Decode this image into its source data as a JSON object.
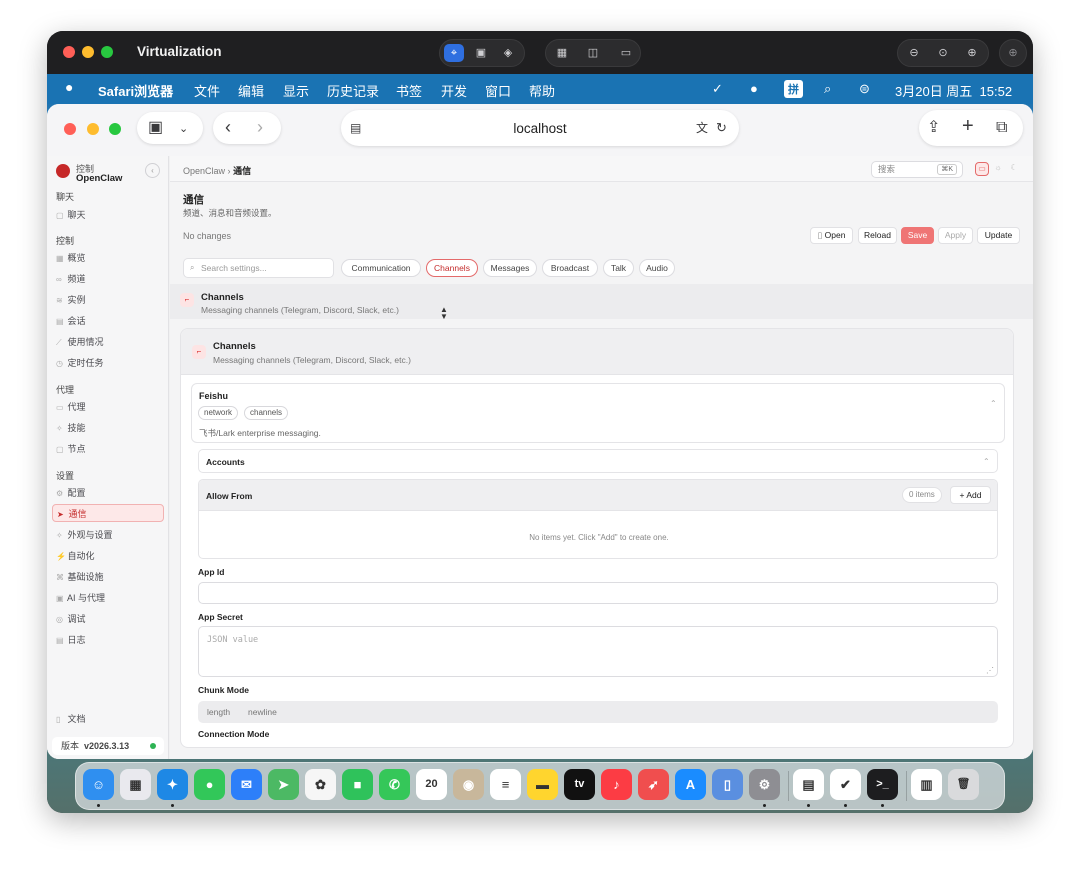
{
  "vm": {
    "title": "Virtualization"
  },
  "menubar": {
    "apple": "",
    "items": [
      "Safari浏览器",
      "文件",
      "编辑",
      "显示",
      "历史记录",
      "书签",
      "开发",
      "窗口",
      "帮助"
    ],
    "input_method": "拼",
    "datetime": "3月20日 周五  15:52"
  },
  "safari": {
    "url": "localhost"
  },
  "sidebar": {
    "brand_small": "控制",
    "brand_name": "OpenClaw",
    "groups": [
      {
        "label": "聊天",
        "items": [
          {
            "label": "聊天",
            "icon": "chat-icon"
          }
        ]
      },
      {
        "label": "控制",
        "items": [
          {
            "label": "概览",
            "icon": "overview-icon"
          },
          {
            "label": "频道",
            "icon": "link-icon"
          },
          {
            "label": "实例",
            "icon": "instance-icon"
          },
          {
            "label": "会话",
            "icon": "session-icon"
          },
          {
            "label": "使用情况",
            "icon": "usage-icon"
          },
          {
            "label": "定时任务",
            "icon": "clock-icon"
          }
        ]
      },
      {
        "label": "代理",
        "items": [
          {
            "label": "代理",
            "icon": "folder-icon"
          },
          {
            "label": "技能",
            "icon": "skill-icon"
          },
          {
            "label": "节点",
            "icon": "node-icon"
          }
        ]
      },
      {
        "label": "设置",
        "items": [
          {
            "label": "配置",
            "icon": "gear-icon"
          },
          {
            "label": "通信",
            "icon": "send-icon"
          },
          {
            "label": "外观与设置",
            "icon": "appearance-icon"
          },
          {
            "label": "自动化",
            "icon": "automation-icon"
          },
          {
            "label": "基础设施",
            "icon": "infra-icon"
          },
          {
            "label": "AI 与代理",
            "icon": "ai-icon"
          },
          {
            "label": "调试",
            "icon": "debug-icon"
          },
          {
            "label": "日志",
            "icon": "log-icon"
          }
        ]
      }
    ],
    "active_item": "通信",
    "docs_label": "文档",
    "version_label": "版本",
    "version_value": "v2026.3.13"
  },
  "header": {
    "breadcrumb_root": "OpenClaw",
    "breadcrumb_sep": "›",
    "breadcrumb_current": "通信",
    "search_placeholder": "搜索",
    "search_shortcut": "⌘K"
  },
  "page": {
    "title": "通信",
    "subtitle": "频道、消息和音频设置。",
    "status": "No changes",
    "actions": {
      "open": "Open",
      "reload": "Reload",
      "save": "Save",
      "apply": "Apply",
      "update": "Update"
    },
    "search_placeholder": "Search settings...",
    "tabs": [
      "Communication",
      "Channels",
      "Messages",
      "Broadcast",
      "Talk",
      "Audio"
    ],
    "active_tab": "Channels"
  },
  "section": {
    "title": "Channels",
    "description": "Messaging channels (Telegram, Discord, Slack, etc.)"
  },
  "card": {
    "title": "Channels",
    "description": "Messaging channels (Telegram, Discord, Slack, etc.)",
    "feishu": {
      "title": "Feishu",
      "tags": [
        "network",
        "channels"
      ],
      "description": "飞书/Lark enterprise messaging."
    },
    "accounts_label": "Accounts",
    "allow_from": {
      "label": "Allow From",
      "count": "0 items",
      "add": "+ Add",
      "empty": "No items yet. Click \"Add\" to create one."
    },
    "app_id_label": "App Id",
    "app_id_value": "",
    "app_secret_label": "App Secret",
    "app_secret_placeholder": "JSON value",
    "chunk_mode_label": "Chunk Mode",
    "chunk_mode_options": [
      "length",
      "newline"
    ],
    "connection_mode_label": "Connection Mode"
  },
  "dock": {
    "apps": [
      {
        "name": "Finder",
        "icon": "finder-icon",
        "color": "#2f8ff0",
        "glyph": "☺",
        "running": true
      },
      {
        "name": "Launchpad",
        "icon": "launchpad-icon",
        "color": "#e9e9ee",
        "glyph": "▦",
        "running": false
      },
      {
        "name": "Safari",
        "icon": "safari-icon",
        "color": "#1e88e5",
        "glyph": "✦",
        "running": true
      },
      {
        "name": "Messages",
        "icon": "messages-icon",
        "color": "#32c759",
        "glyph": "●",
        "running": false
      },
      {
        "name": "Mail",
        "icon": "mail-icon",
        "color": "#2d7ff9",
        "glyph": "✉",
        "running": false
      },
      {
        "name": "Maps",
        "icon": "maps-icon",
        "color": "#4cb964",
        "glyph": "➤",
        "running": false
      },
      {
        "name": "Photos",
        "icon": "photos-icon",
        "color": "#f6f6f6",
        "glyph": "✿",
        "running": false
      },
      {
        "name": "FaceTime",
        "icon": "facetime-icon",
        "color": "#2fc25b",
        "glyph": "■",
        "running": false
      },
      {
        "name": "Phone",
        "icon": "phone-icon",
        "color": "#35c759",
        "glyph": "✆",
        "running": false
      },
      {
        "name": "Calendar",
        "icon": "calendar-icon",
        "color": "#ffffff",
        "glyph": "20",
        "running": false
      },
      {
        "name": "Contacts",
        "icon": "contacts-icon",
        "color": "#c8b79b",
        "glyph": "◉",
        "running": false
      },
      {
        "name": "Reminders",
        "icon": "reminders-icon",
        "color": "#ffffff",
        "glyph": "≡",
        "running": false
      },
      {
        "name": "Notes",
        "icon": "notes-icon",
        "color": "#ffd52e",
        "glyph": "▬",
        "running": false
      },
      {
        "name": "TV",
        "icon": "tv-icon",
        "color": "#111111",
        "glyph": "tv",
        "running": false
      },
      {
        "name": "Music",
        "icon": "music-icon",
        "color": "#fc3c44",
        "glyph": "♪",
        "running": false
      },
      {
        "name": "Rocket",
        "icon": "rocket-icon",
        "color": "#f04e4e",
        "glyph": "➶",
        "running": false
      },
      {
        "name": "App Store",
        "icon": "appstore-icon",
        "color": "#1a8cff",
        "glyph": "A",
        "running": false
      },
      {
        "name": "Preview",
        "icon": "preview-icon",
        "color": "#5a8fe0",
        "glyph": "▯",
        "running": false
      },
      {
        "name": "System Settings",
        "icon": "settings-icon",
        "color": "#8e8e93",
        "glyph": "⚙",
        "running": true
      },
      {
        "name": "Sheet",
        "icon": "sheet-icon",
        "color": "#ffffff",
        "glyph": "▤",
        "running": true
      },
      {
        "name": "Copilot",
        "icon": "bird-icon",
        "color": "#ffffff",
        "glyph": "✔",
        "running": true
      },
      {
        "name": "Terminal",
        "icon": "terminal-icon",
        "color": "#1d1d1f",
        "glyph": ">_",
        "running": true
      },
      {
        "name": "Document",
        "icon": "document-icon",
        "color": "#ffffff",
        "glyph": "▥",
        "running": false
      },
      {
        "name": "Trash",
        "icon": "trash-icon",
        "color": "#d9dadc",
        "glyph": "🗑",
        "running": false
      }
    ]
  },
  "colors": {
    "accent": "#e46a6a",
    "menubar": "#1a73b3",
    "status_ok": "#2eb354"
  }
}
